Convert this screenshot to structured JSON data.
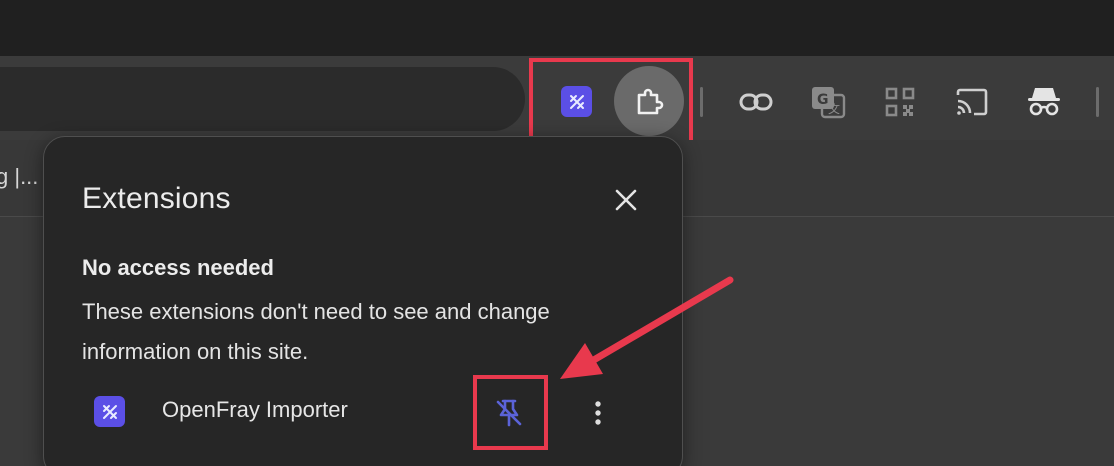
{
  "browser": {
    "bookmark_fragment": "g |...",
    "toolbar_icons": [
      "extension-logo-icon",
      "extensions-puzzle-icon",
      "link-icon",
      "translate-icon",
      "qr-code-icon",
      "cast-icon",
      "incognito-icon"
    ]
  },
  "popup": {
    "title": "Extensions",
    "close_icon": "close-icon",
    "section": {
      "heading": "No access needed",
      "description": "These extensions don't need to see and change information on this site."
    },
    "extensions": [
      {
        "name": "OpenFray Importer",
        "icon": "openfray-logo-icon",
        "pin_state": "unpin-icon",
        "menu_icon": "more-vert-icon"
      }
    ]
  },
  "colors": {
    "highlight": "#e8394d",
    "extension_brand": "#5b4fe6",
    "popup_bg": "#262626",
    "toolbar_bg": "#3b3b3b",
    "titlebar_bg": "#202020"
  }
}
